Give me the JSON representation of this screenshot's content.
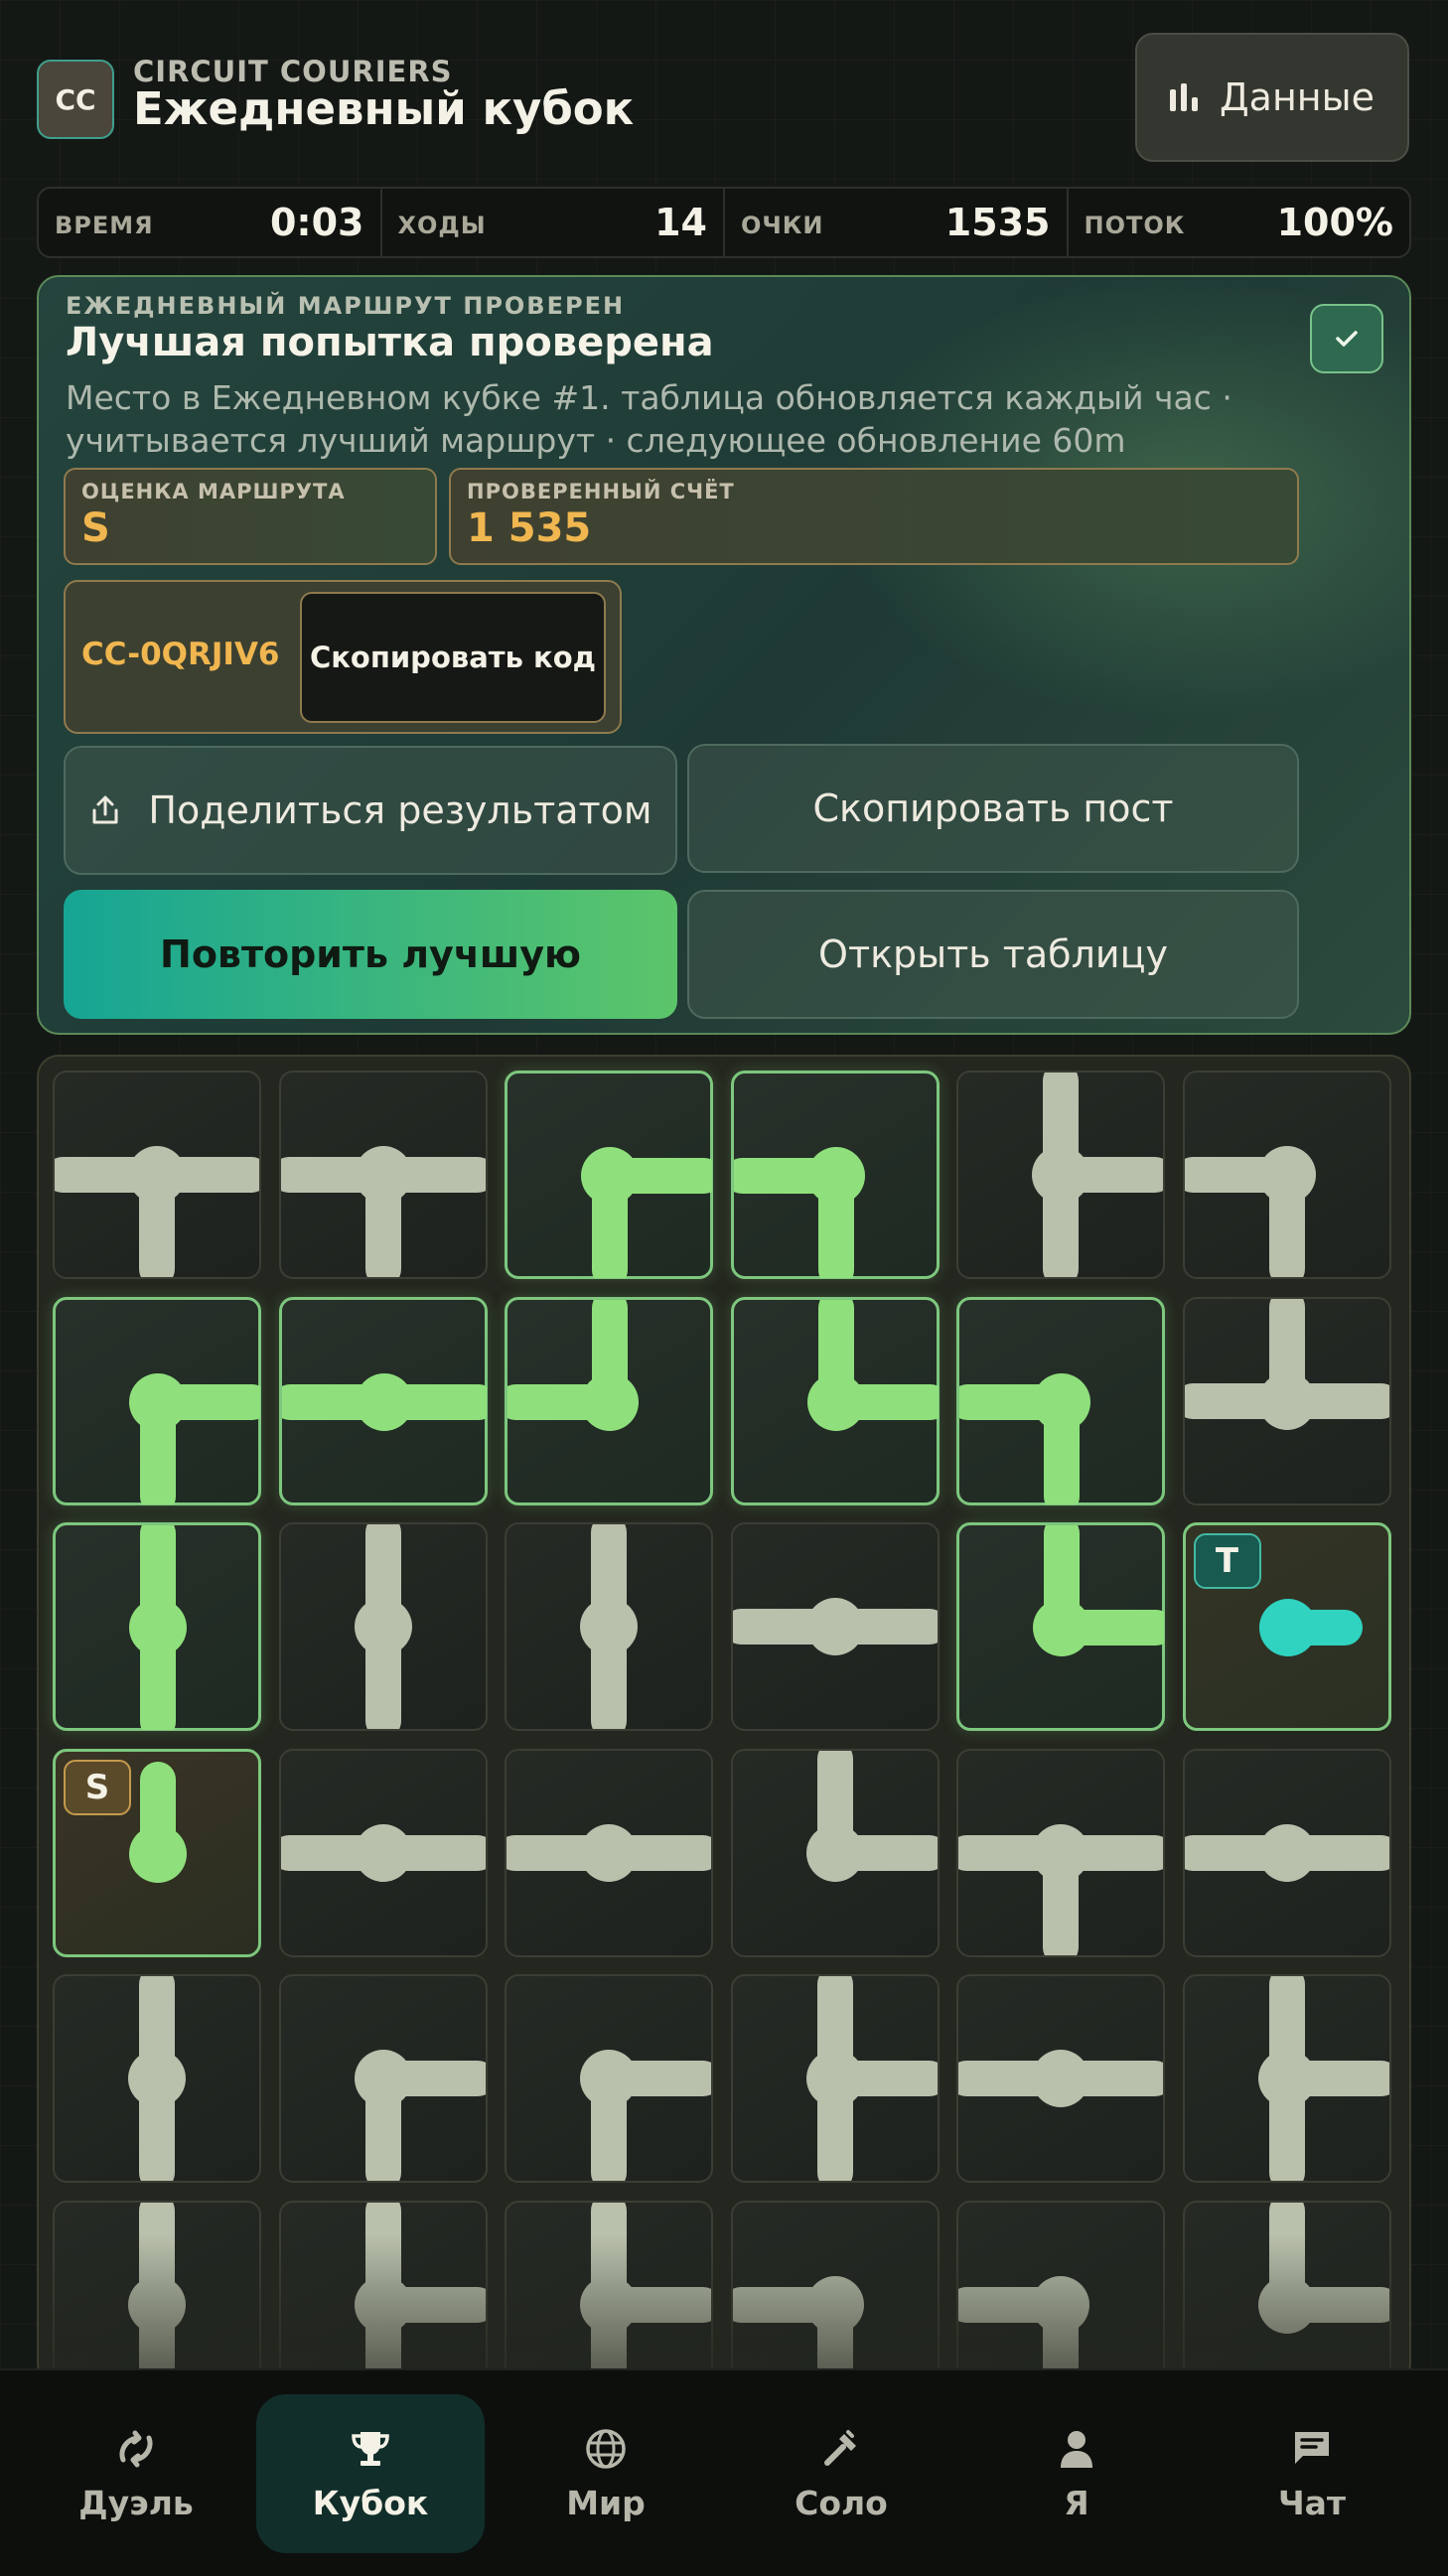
{
  "header": {
    "logo_text": "CC",
    "app_name": "CIRCUIT COURIERS",
    "title": "Ежедневный кубок",
    "data_button": "Данные",
    "data_icon": "bar-chart-icon"
  },
  "stats": [
    {
      "label": "ВРЕМЯ",
      "value": "0:03"
    },
    {
      "label": "ХОДЫ",
      "value": "14"
    },
    {
      "label": "ОЧКИ",
      "value": "1535"
    },
    {
      "label": "ПОТОК",
      "value": "100%"
    }
  ],
  "result": {
    "kicker": "ЕЖЕДНЕВНЫЙ МАРШРУТ ПРОВЕРЕН",
    "title": "Лучшая попытка проверена",
    "description": "Место в Ежедневном кубке #1. таблица обновляется каждый час · учитывается лучший маршрут · следующее обновление 60m",
    "grade_label": "ОЦЕНКА МАРШРУТА",
    "grade_value": "S",
    "score_label": "ПРОВЕРЕННЫЙ СЧЁТ",
    "score_value": "1 535",
    "code": "CC-0QRJIV6",
    "copy_code_label": "Скопировать код",
    "share_label": "Поделиться результатом",
    "copy_post_label": "Скопировать пост",
    "replay_label": "Повторить лучшую",
    "open_table_label": "Открыть таблицу"
  },
  "board": {
    "columns": 6,
    "rows_visible": 6,
    "colors": {
      "lit": "#8fe07c",
      "idle": "#b9c0ac",
      "target": "#2fd3c0"
    },
    "source_badge": "S",
    "target_badge": "T",
    "tiles": [
      [
        {
          "ports": "ESW",
          "lit": false
        },
        {
          "ports": "ESW",
          "lit": false
        },
        {
          "ports": "ES",
          "lit": true
        },
        {
          "ports": "SW",
          "lit": true
        },
        {
          "ports": "NES",
          "lit": false
        },
        {
          "ports": "SW",
          "lit": false
        }
      ],
      [
        {
          "ports": "ES",
          "lit": true
        },
        {
          "ports": "EW",
          "lit": true
        },
        {
          "ports": "NW",
          "lit": true
        },
        {
          "ports": "NE",
          "lit": true
        },
        {
          "ports": "SW",
          "lit": true
        },
        {
          "ports": "NEW",
          "lit": false
        }
      ],
      [
        {
          "ports": "NS",
          "lit": true
        },
        {
          "ports": "NS",
          "lit": false
        },
        {
          "ports": "NS",
          "lit": false
        },
        {
          "ports": "EW",
          "lit": false
        },
        {
          "ports": "NE",
          "lit": true
        },
        {
          "ports": "E",
          "lit": false,
          "role": "target"
        }
      ],
      [
        {
          "ports": "N",
          "lit": true,
          "role": "source"
        },
        {
          "ports": "EW",
          "lit": false
        },
        {
          "ports": "EW",
          "lit": false
        },
        {
          "ports": "NE",
          "lit": false
        },
        {
          "ports": "ESW",
          "lit": false
        },
        {
          "ports": "EW",
          "lit": false
        }
      ],
      [
        {
          "ports": "NS",
          "lit": false
        },
        {
          "ports": "ES",
          "lit": false
        },
        {
          "ports": "ES",
          "lit": false
        },
        {
          "ports": "NES",
          "lit": false
        },
        {
          "ports": "EW",
          "lit": false
        },
        {
          "ports": "NES",
          "lit": false
        }
      ],
      [
        {
          "ports": "NS",
          "lit": false
        },
        {
          "ports": "NES",
          "lit": false
        },
        {
          "ports": "NES",
          "lit": false
        },
        {
          "ports": "SW",
          "lit": false
        },
        {
          "ports": "SW",
          "lit": false
        },
        {
          "ports": "NE",
          "lit": false
        }
      ]
    ]
  },
  "nav": [
    {
      "label": "Дуэль",
      "icon": "swords-icon",
      "active": false
    },
    {
      "label": "Кубок",
      "icon": "trophy-icon",
      "active": true
    },
    {
      "label": "Мир",
      "icon": "globe-icon",
      "active": false
    },
    {
      "label": "Соло",
      "icon": "hammer-icon",
      "active": false
    },
    {
      "label": "Я",
      "icon": "user-icon",
      "active": false
    },
    {
      "label": "Чат",
      "icon": "chat-icon",
      "active": false
    }
  ]
}
